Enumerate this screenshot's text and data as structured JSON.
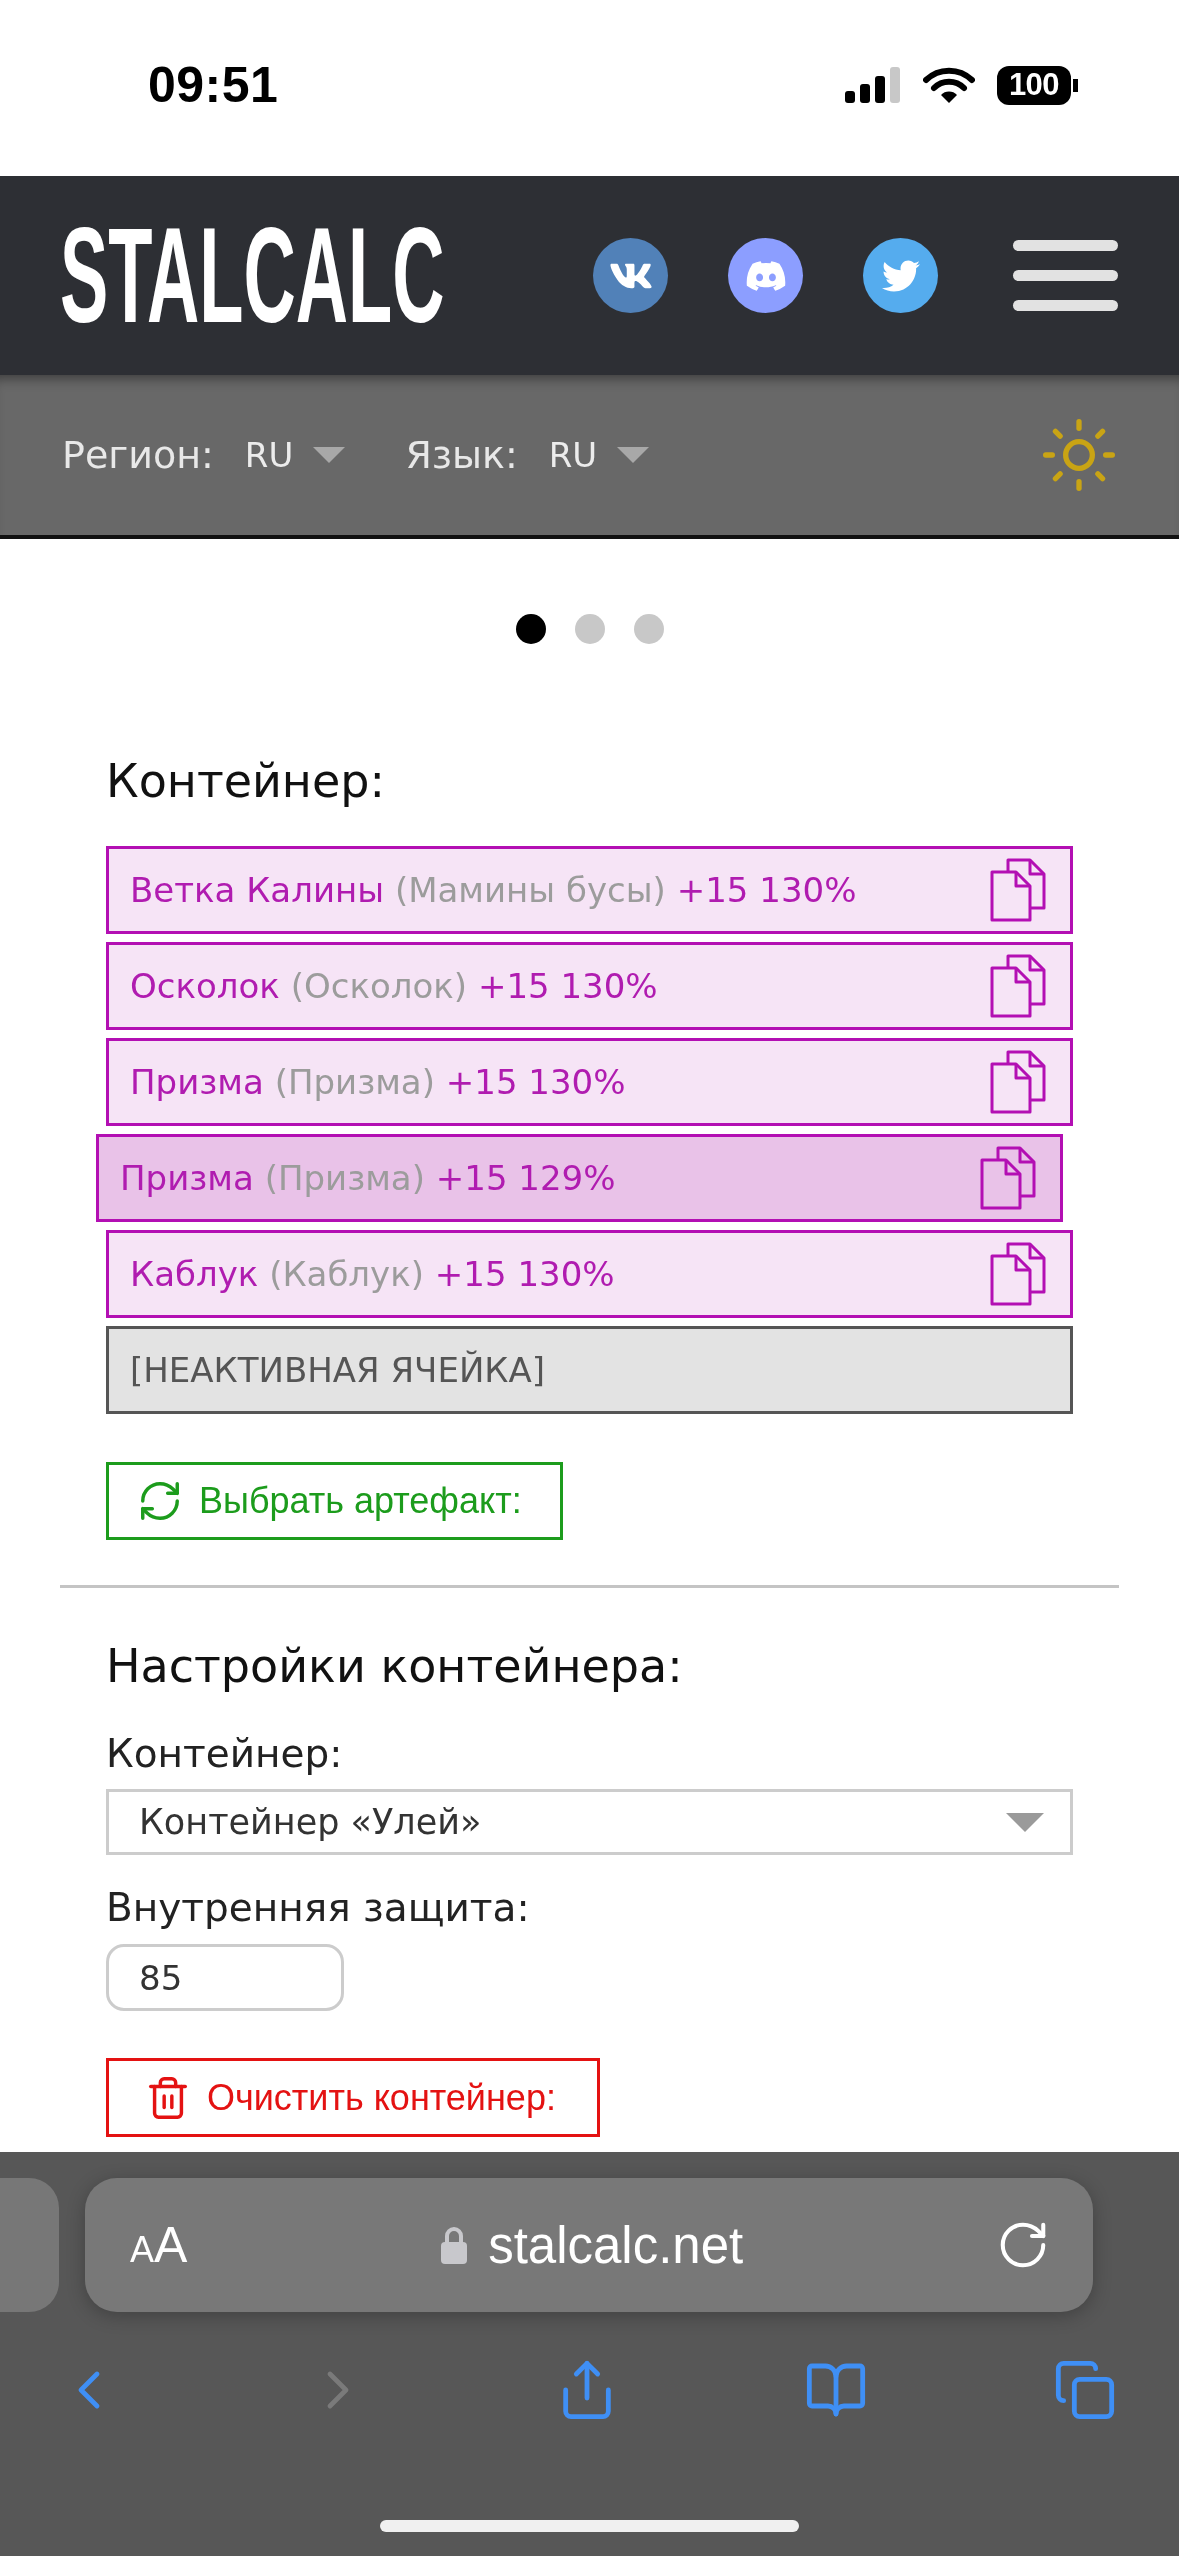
{
  "status_bar": {
    "time": "09:51",
    "battery": "100"
  },
  "header": {
    "logo": "STALCALC"
  },
  "toolbar": {
    "region": {
      "label": "Регион:",
      "value": "RU"
    },
    "language": {
      "label": "Язык:",
      "value": "RU"
    }
  },
  "carousel": {
    "dots": [
      {
        "selected": true
      },
      {
        "selected": false
      },
      {
        "selected": false
      }
    ]
  },
  "container": {
    "title": "Контейнер:",
    "slots": [
      {
        "kind": "artifact",
        "name": "Ветка Калины",
        "alias": "(Мамины бусы)",
        "stats": "+15 130%",
        "selected": false
      },
      {
        "kind": "artifact",
        "name": "Осколок",
        "alias": "(Осколок)",
        "stats": "+15 130%",
        "selected": false
      },
      {
        "kind": "artifact",
        "name": "Призма",
        "alias": "(Призма)",
        "stats": "+15 130%",
        "selected": false
      },
      {
        "kind": "artifact",
        "name": "Призма",
        "alias": "(Призма)",
        "stats": "+15 129%",
        "selected": true
      },
      {
        "kind": "artifact",
        "name": "Каблук",
        "alias": "(Каблук)",
        "stats": "+15 130%",
        "selected": false
      },
      {
        "kind": "inactive",
        "text": "[НЕАКТИВНАЯ ЯЧЕЙКА]"
      }
    ],
    "pick_button": "Выбрать артефакт:"
  },
  "settings": {
    "title": "Настройки контейнера:",
    "container_field": {
      "label": "Контейнер:",
      "value": "Контейнер «Улей»"
    },
    "protection_field": {
      "label": "Внутренняя защита:",
      "value": "85"
    },
    "clear_button": "Очистить контейнер:"
  },
  "browser": {
    "text_size_button": "AA",
    "url": "stalcalc.net",
    "nav_buttons": [
      {
        "kind": "back",
        "disabled": false
      },
      {
        "kind": "forward",
        "disabled": true
      },
      {
        "kind": "share",
        "disabled": false
      },
      {
        "kind": "bookmarks",
        "disabled": false
      },
      {
        "kind": "tabs",
        "disabled": false
      }
    ]
  }
}
